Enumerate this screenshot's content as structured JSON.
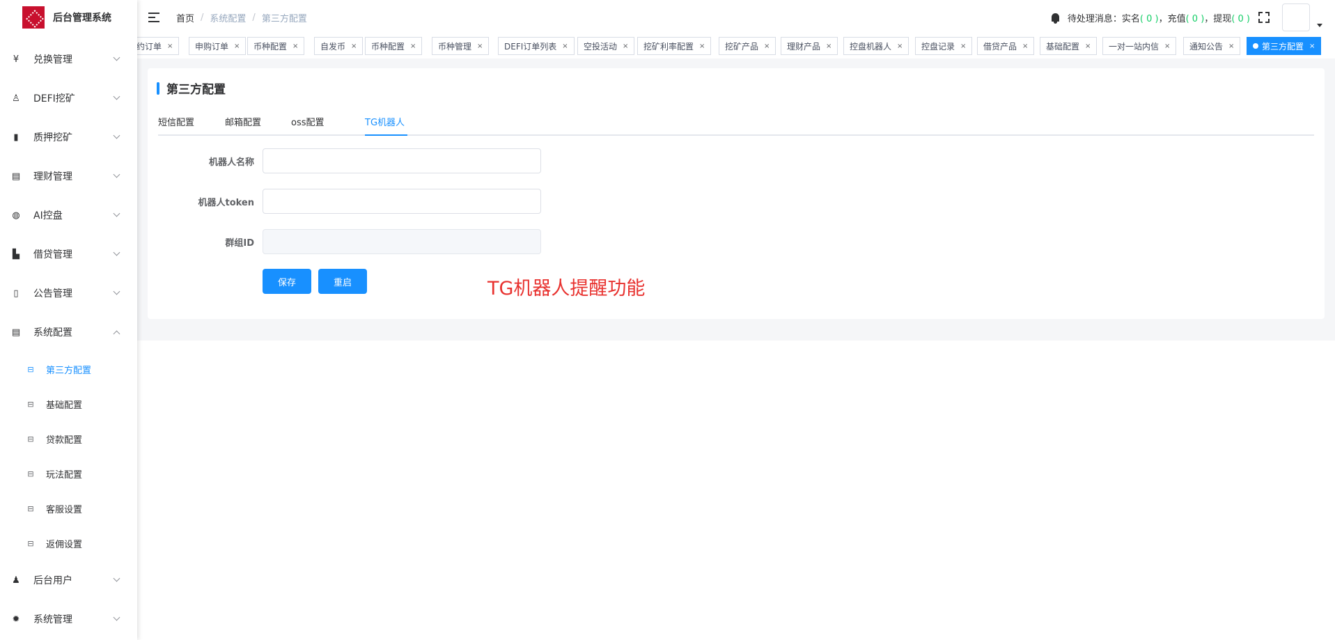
{
  "app": {
    "title": "后台管理系统"
  },
  "sidebar": {
    "items": [
      {
        "label": "兑换管理",
        "icon": "yen-icon"
      },
      {
        "label": "DEFI挖矿",
        "icon": "user-icon"
      },
      {
        "label": "质押挖矿",
        "icon": "bar-chart-icon"
      },
      {
        "label": "理财管理",
        "icon": "document-icon"
      },
      {
        "label": "AI控盘",
        "icon": "robot-icon"
      },
      {
        "label": "借贷管理",
        "icon": "book-icon"
      },
      {
        "label": "公告管理",
        "icon": "open-book-icon"
      },
      {
        "label": "系统配置",
        "icon": "document-icon",
        "expanded": true
      }
    ],
    "sub_items": [
      {
        "label": "第三方配置",
        "active": true
      },
      {
        "label": "基础配置"
      },
      {
        "label": "贷款配置"
      },
      {
        "label": "玩法配置"
      },
      {
        "label": "客服设置"
      },
      {
        "label": "返佣设置"
      }
    ],
    "bottom_items": [
      {
        "label": "后台用户",
        "icon": "users-icon"
      },
      {
        "label": "系统管理",
        "icon": "gear-icon"
      }
    ]
  },
  "header": {
    "breadcrumb": [
      "首页",
      "系统配置",
      "第三方配置"
    ],
    "pending_label": "待处理消息：",
    "realname_label": "实名",
    "realname_count": "( 0 )",
    "recharge_label": "充值",
    "recharge_count": "( 0 )",
    "withdraw_label": "提现",
    "withdraw_count": "( 0 )",
    "sep": "，"
  },
  "tags": [
    "约订单",
    "申购订单",
    "币种配置",
    "自发币",
    "币种配置",
    "币种管理",
    "DEFI订单列表",
    "空投活动",
    "挖矿利率配置",
    "挖矿产品",
    "理财产品",
    "控盘机器人",
    "控盘记录",
    "借贷产品",
    "基础配置",
    "一对一站内信",
    "通知公告",
    "第三方配置"
  ],
  "page": {
    "title": "第三方配置",
    "tabs": [
      "短信配置",
      "邮箱配置",
      "oss配置",
      "TG机器人"
    ],
    "active_tab": "TG机器人",
    "form": {
      "bot_name_label": "机器人名称",
      "bot_name_value": "",
      "bot_token_label": "机器人token",
      "bot_token_value": "",
      "group_id_label": "群组ID",
      "group_id_value": ""
    },
    "save_label": "保存",
    "reset_label": "重启",
    "annotation": "TG机器人提醒功能"
  },
  "colors": {
    "accent": "#1890ff",
    "count": "#13ce66",
    "annotation": "#e8322f",
    "logo": "#c8102e"
  }
}
